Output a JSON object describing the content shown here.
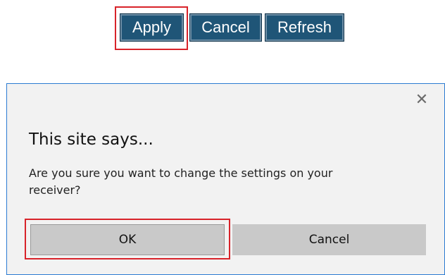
{
  "toolbar": {
    "apply_label": "Apply",
    "cancel_label": "Cancel",
    "refresh_label": "Refresh"
  },
  "dialog": {
    "close_icon": "close-icon",
    "title": "This site says...",
    "message": "Are you sure you want to change the settings on your receiver?",
    "ok_label": "OK",
    "cancel_label": "Cancel"
  },
  "annotations": {
    "highlight_color": "#d8232a",
    "highlighted": [
      "Apply",
      "OK"
    ]
  },
  "colors": {
    "toolbar_button": "#1f5577",
    "dialog_background": "#f2f2f2",
    "dialog_button": "#c9c9c9",
    "dialog_border": "#2b7bd2"
  }
}
